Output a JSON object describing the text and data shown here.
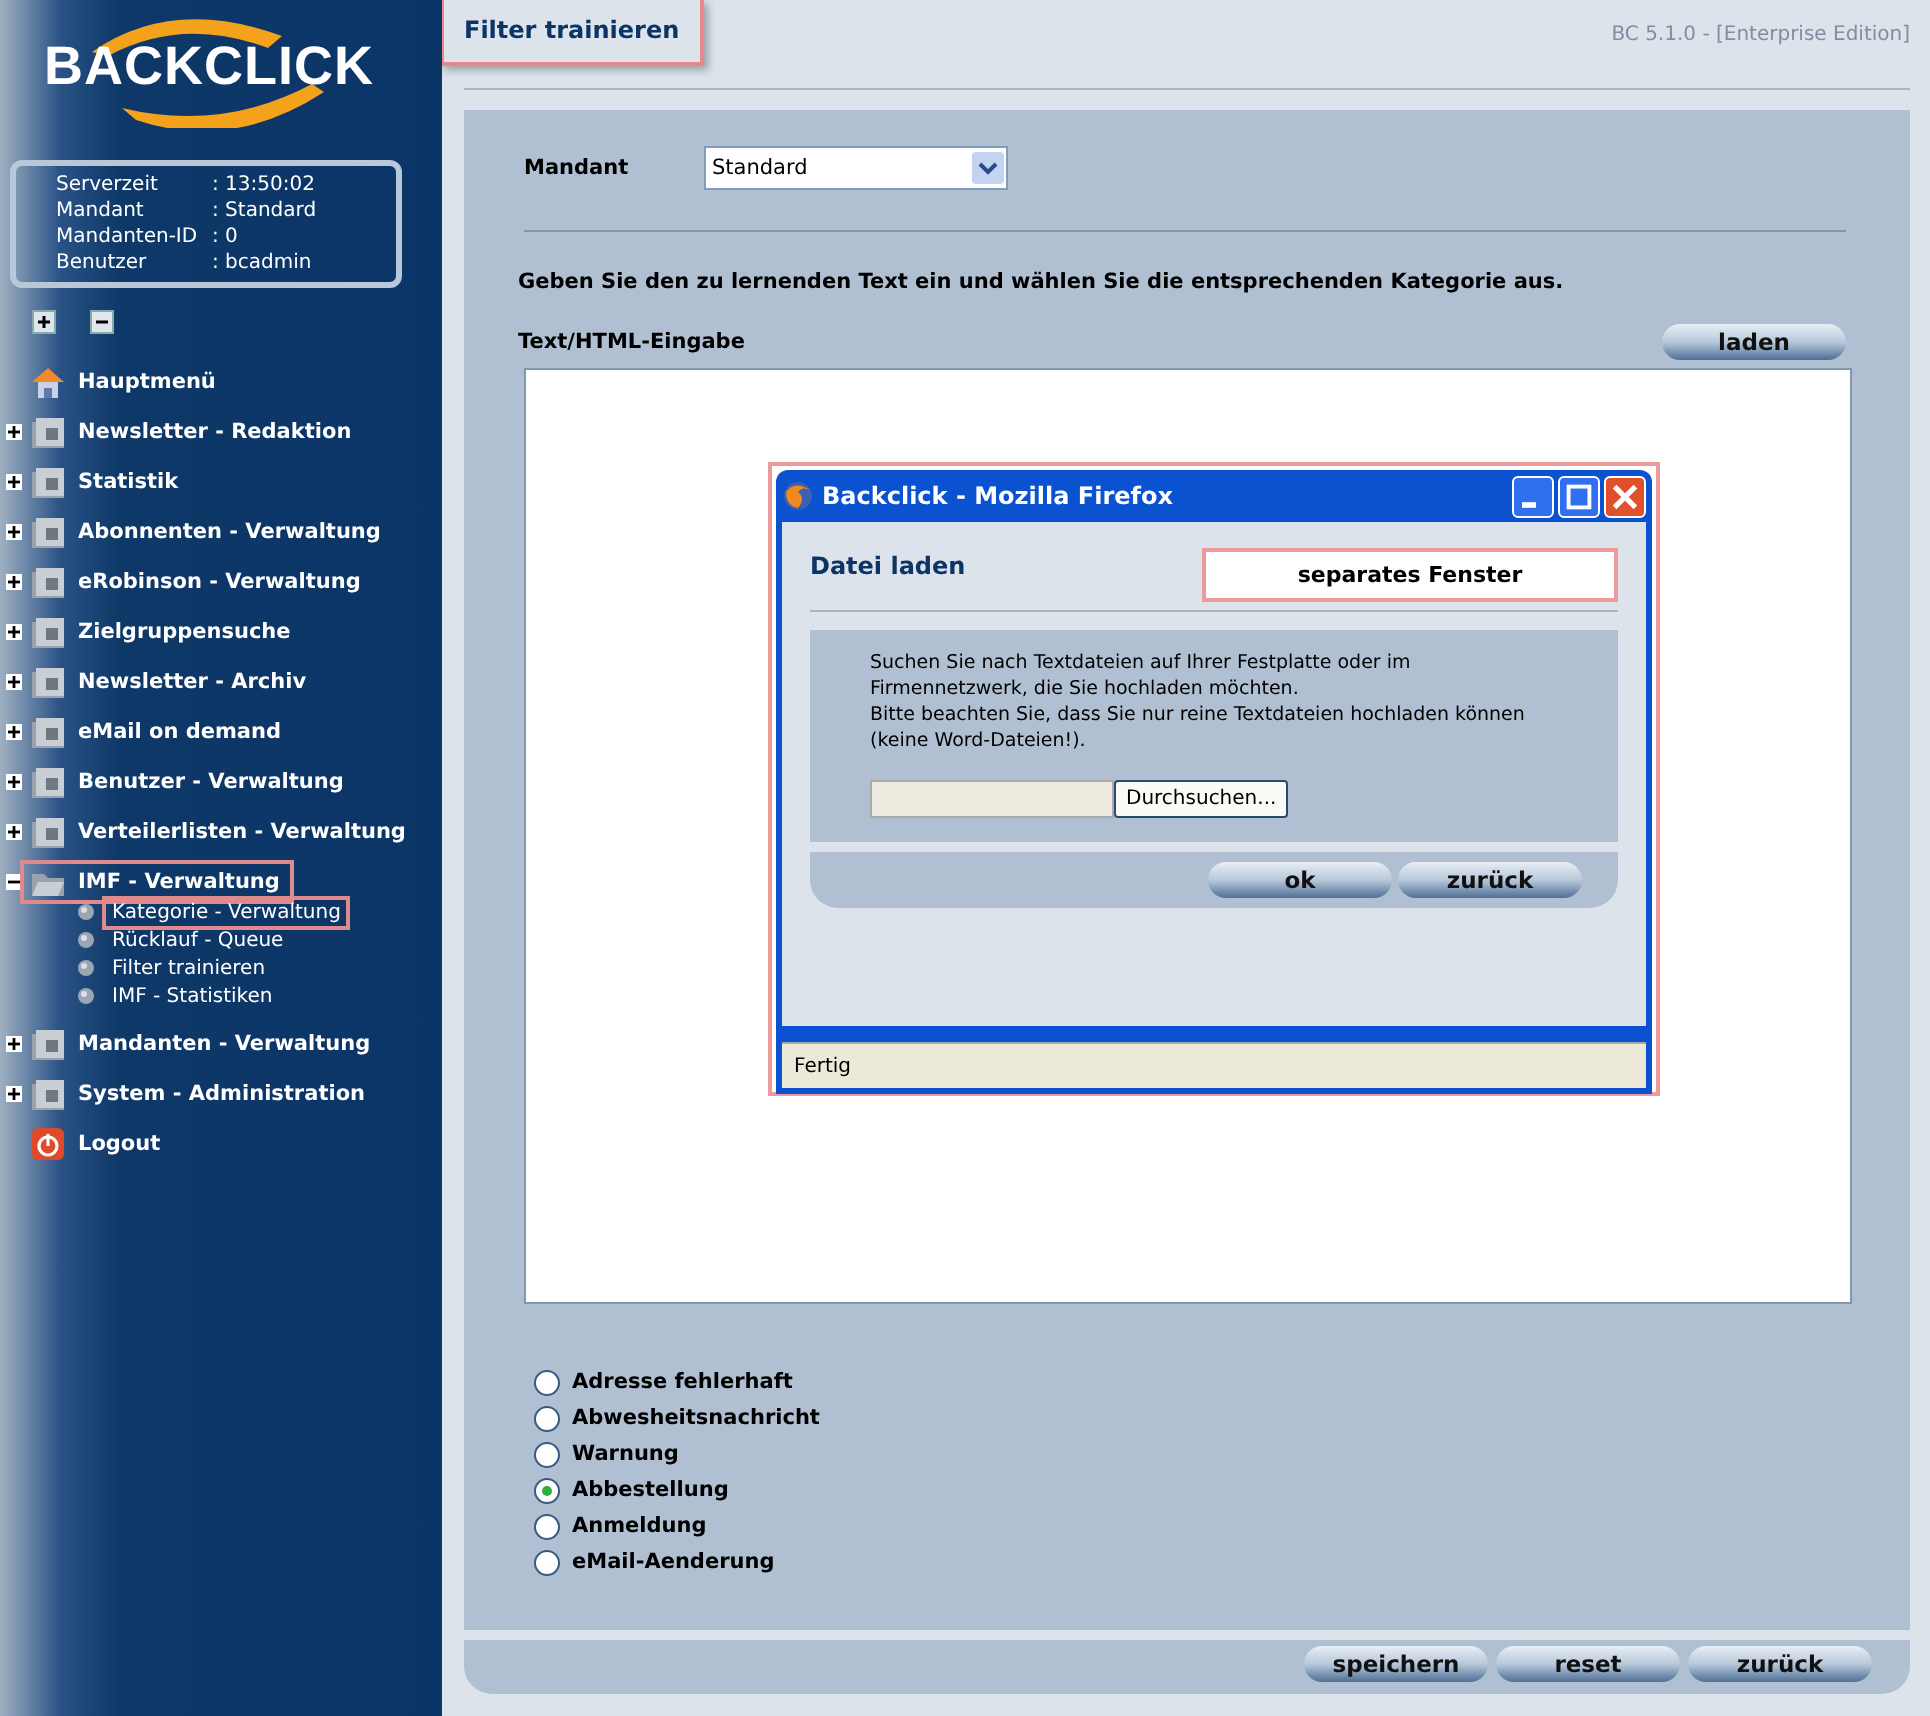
{
  "header": {
    "title": "Filter trainieren",
    "highlighted": true,
    "version": "BC 5.1.0 - [Enterprise Edition]"
  },
  "logo": "BACKCLICK",
  "info": [
    {
      "label": "Serverzeit",
      "value": ": 13:50:02"
    },
    {
      "label": "Mandant",
      "value": ": Standard"
    },
    {
      "label": "Mandanten-ID",
      "value": ": 0"
    },
    {
      "label": "Benutzer",
      "value": ": bcadmin"
    }
  ],
  "menu": [
    {
      "label": "Hauptmenü",
      "kind": "home",
      "highlighted": false
    },
    {
      "label": "Newsletter - Redaktion",
      "kind": "folder",
      "expanded": false,
      "highlighted": false
    },
    {
      "label": "Statistik",
      "kind": "folder",
      "expanded": false,
      "highlighted": false
    },
    {
      "label": "Abonnenten - Verwaltung",
      "kind": "folder",
      "expanded": false,
      "highlighted": false
    },
    {
      "label": "eRobinson - Verwaltung",
      "kind": "folder",
      "expanded": false,
      "highlighted": false
    },
    {
      "label": "Zielgruppensuche",
      "kind": "folder",
      "expanded": false,
      "highlighted": false
    },
    {
      "label": "Newsletter - Archiv",
      "kind": "folder",
      "expanded": false,
      "highlighted": false
    },
    {
      "label": "eMail on demand",
      "kind": "folder",
      "expanded": false,
      "highlighted": false
    },
    {
      "label": "Benutzer - Verwaltung",
      "kind": "folder",
      "expanded": false,
      "highlighted": false
    },
    {
      "label": "Verteilerlisten - Verwaltung",
      "kind": "folder",
      "expanded": false,
      "highlighted": false
    },
    {
      "label": "IMF - Verwaltung",
      "kind": "folder",
      "expanded": true,
      "highlighted": true,
      "children": [
        {
          "label": "Kategorie - Verwaltung",
          "highlighted": true
        },
        {
          "label": "Rücklauf - Queue",
          "highlighted": false
        },
        {
          "label": "Filter trainieren",
          "highlighted": false
        },
        {
          "label": "IMF - Statistiken",
          "highlighted": false
        }
      ]
    },
    {
      "label": "Mandanten - Verwaltung",
      "kind": "folder",
      "expanded": false,
      "highlighted": false
    },
    {
      "label": "System - Administration",
      "kind": "folder",
      "expanded": false,
      "highlighted": false
    },
    {
      "label": "Logout",
      "kind": "logout",
      "highlighted": false
    }
  ],
  "form": {
    "mandant_label": "Mandant",
    "mandant_value": "Standard",
    "instruction": "Geben Sie den zu lernenden Text ein und wählen Sie die entsprechenden Kategorie aus.",
    "text_label": "Text/HTML-Eingabe",
    "load_button": "laden",
    "radios": [
      {
        "label": "Adresse fehlerhaft",
        "selected": false
      },
      {
        "label": "Abwesheitsnachricht",
        "selected": false
      },
      {
        "label": "Warnung",
        "selected": false
      },
      {
        "label": "Abbestellung",
        "selected": true
      },
      {
        "label": "Anmeldung",
        "selected": false
      },
      {
        "label": "eMail-Aenderung",
        "selected": false
      }
    ],
    "buttons": [
      "speichern",
      "reset",
      "zurück"
    ]
  },
  "popup": {
    "title": "Backclick - Mozilla Firefox",
    "heading": "Datei laden",
    "callout": "separates Fenster",
    "text": "Suchen Sie nach Textdateien auf Ihrer Festplatte oder im\nFirmennetzwerk, die Sie hochladen möchten.\nBitte beachten Sie, dass Sie nur reine Textdateien hochladen können\n(keine Word-Dateien!).",
    "browse_button": "Durchsuchen...",
    "buttons": [
      "ok",
      "zurück"
    ],
    "status": "Fertig"
  }
}
